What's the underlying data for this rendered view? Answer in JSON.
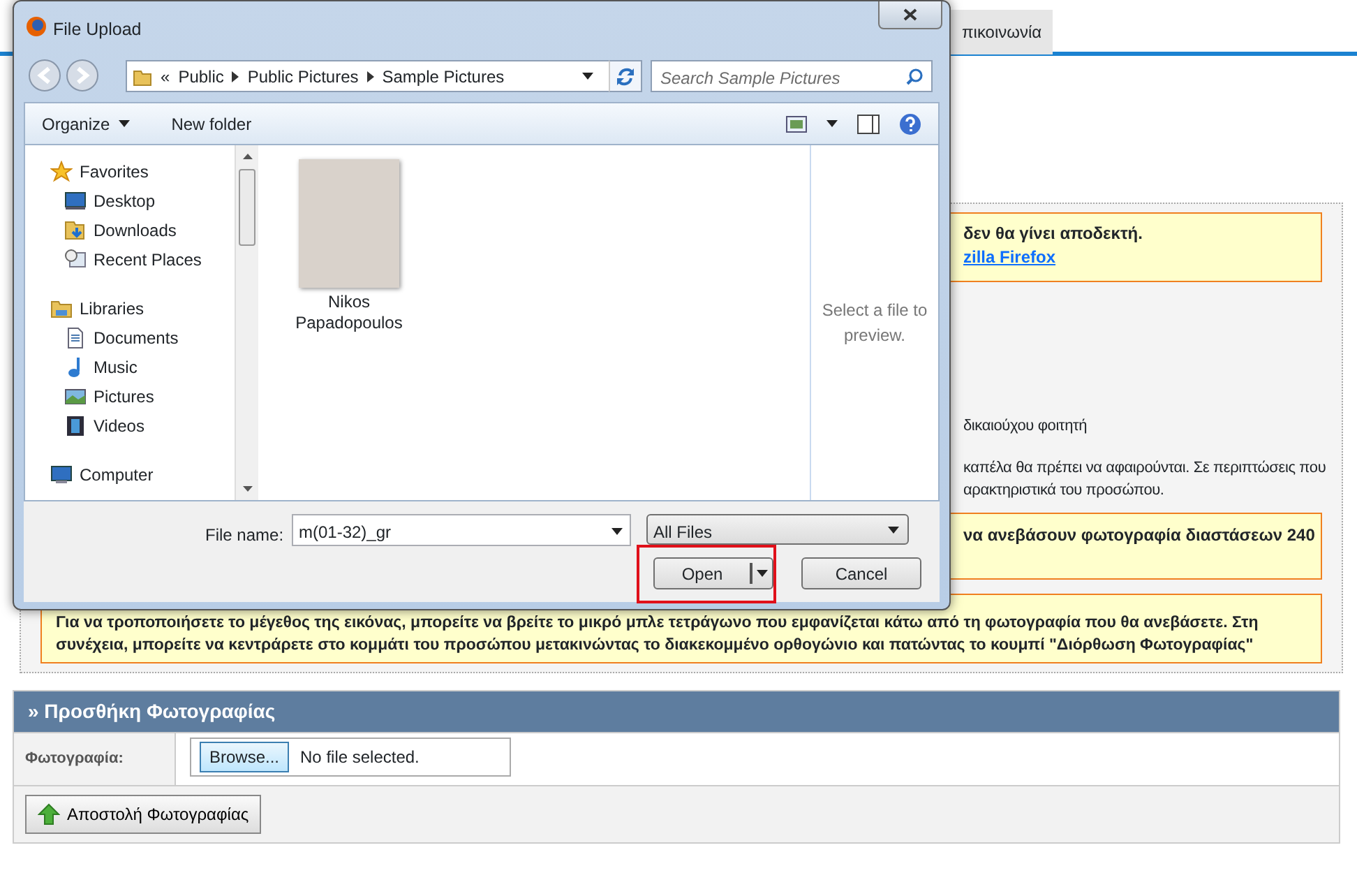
{
  "page": {
    "nav_tabs": [
      {
        "label": "πικοινωνία",
        "selected": false
      }
    ],
    "notice_top": {
      "text": "δεν θα γίνει αποδεκτή.",
      "link": "zilla Firefox"
    },
    "text_fragments": [
      "δικαιούχου φοιτητή",
      "καπέλα θα πρέπει να αφαιρούνται. Σε περιπτώσεις που",
      "αρακτηριστικά του προσώπου."
    ],
    "notice_middle": "να ανεβάσουν φωτογραφία διαστάσεων 240",
    "notice_bottom": "Για να τροποποιήσετε το μέγεθος της εικόνας, μπορείτε να βρείτε το μικρό μπλε τετράγωνο που εμφανίζεται κάτω από τη φωτογραφία που θα ανεβάσετε. Στη συνέχεια, μπορείτε να κεντράρετε στο κομμάτι του προσώπου μετακινώντας το διακεκομμένο ορθογώνιο και πατώντας το κουμπί \"Διόρθωση Φωτογραφίας\"",
    "upload_section": {
      "title": "» Προσθήκη Φωτογραφίας",
      "field_label": "Φωτογραφία:",
      "browse_button": "Browse...",
      "file_status": "No file selected.",
      "submit_button": "Αποστολή Φωτογραφίας"
    }
  },
  "dialog": {
    "title": "File Upload",
    "breadcrumb": [
      "«",
      "Public",
      "Public Pictures",
      "Sample Pictures"
    ],
    "search": {
      "placeholder": "Search Sample Pictures"
    },
    "commands": [
      "Organize",
      "New folder"
    ],
    "nav_tree": [
      {
        "label": "Favorites",
        "children": [
          {
            "label": "Desktop"
          },
          {
            "label": "Downloads"
          },
          {
            "label": "Recent Places"
          }
        ]
      },
      {
        "label": "Libraries",
        "children": [
          {
            "label": "Documents"
          },
          {
            "label": "Music"
          },
          {
            "label": "Pictures"
          },
          {
            "label": "Videos"
          }
        ]
      },
      {
        "label": "Computer"
      }
    ],
    "files": [
      {
        "name": "Nikos Papadopoulos",
        "selected": false
      }
    ],
    "preview_text": "Select a file to preview.",
    "file_name_label": "File name:",
    "file_name": "m(01-32)_gr",
    "file_type": "All Files",
    "buttons": [
      {
        "label": "Open",
        "kind": "split",
        "highlighted": true
      },
      {
        "label": "Cancel",
        "kind": "plain",
        "highlighted": false
      }
    ]
  }
}
